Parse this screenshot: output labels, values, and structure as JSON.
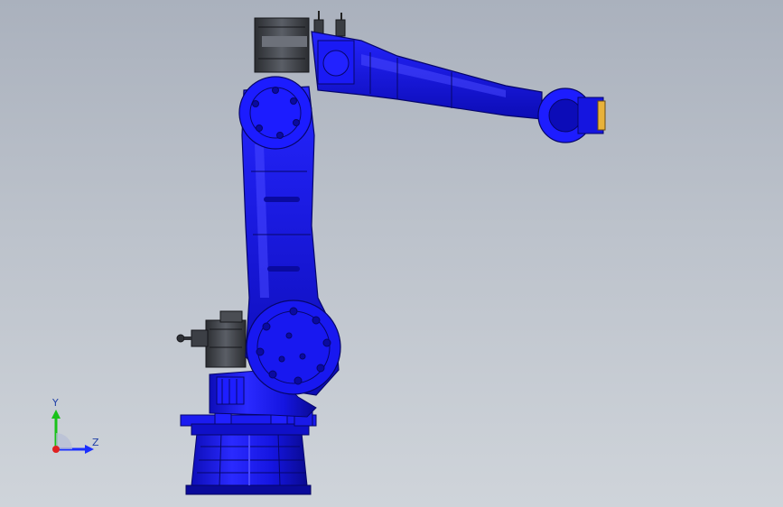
{
  "viewport": {
    "background_top": "#aab1bd",
    "background_bottom": "#cfd4da"
  },
  "model": {
    "part_color": "#1a1aff",
    "shadow_color": "#0a0a9a",
    "motor_color": "#3a3d42",
    "flange_accent": "#e8b23a"
  },
  "triad": {
    "y_label": "Y",
    "z_label": "Z",
    "y_color": "#19c219",
    "z_color": "#1b2fff",
    "x_color": "#e02020"
  }
}
